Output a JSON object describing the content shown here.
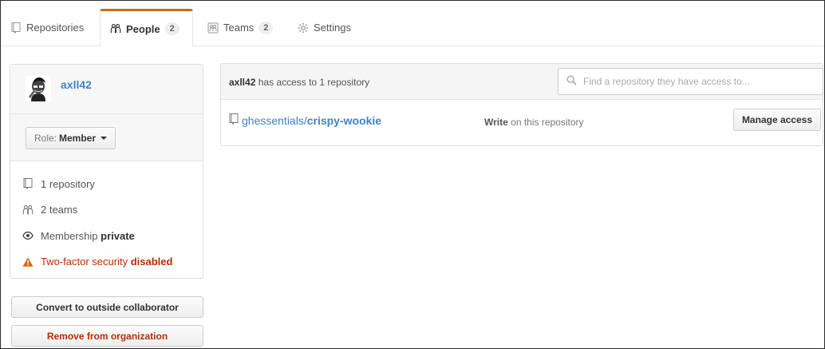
{
  "tabs": [
    {
      "label": "Repositories",
      "icon": "repo-icon",
      "selected": false
    },
    {
      "label": "People",
      "count": "2",
      "icon": "people-icon",
      "selected": true
    },
    {
      "label": "Teams",
      "count": "2",
      "icon": "team-icon",
      "selected": false
    },
    {
      "label": "Settings",
      "icon": "gear-icon",
      "selected": false
    }
  ],
  "member": {
    "username": "axll42",
    "role_prefix": "Role:",
    "role": "Member",
    "stats": {
      "repositories": "1 repository",
      "teams": "2 teams",
      "membership_prefix": "Membership",
      "membership": "private",
      "twofactor_prefix": "Two-factor security",
      "twofactor": "disabled"
    },
    "actions": {
      "convert": "Convert to outside collaborator",
      "remove": "Remove from organization"
    }
  },
  "access": {
    "header_user": "axll42",
    "header_text": "has access to 1 repository",
    "search_placeholder": "Find a repository they have access to...",
    "repos": [
      {
        "owner": "ghessentials/",
        "name": "crispy-wookie",
        "permission": "Write",
        "permission_suffix": "on this repository",
        "action": "Manage access"
      }
    ]
  },
  "colors": {
    "accent_tab": "#d26911",
    "link": "#4183c4",
    "danger": "#bd2c00"
  }
}
